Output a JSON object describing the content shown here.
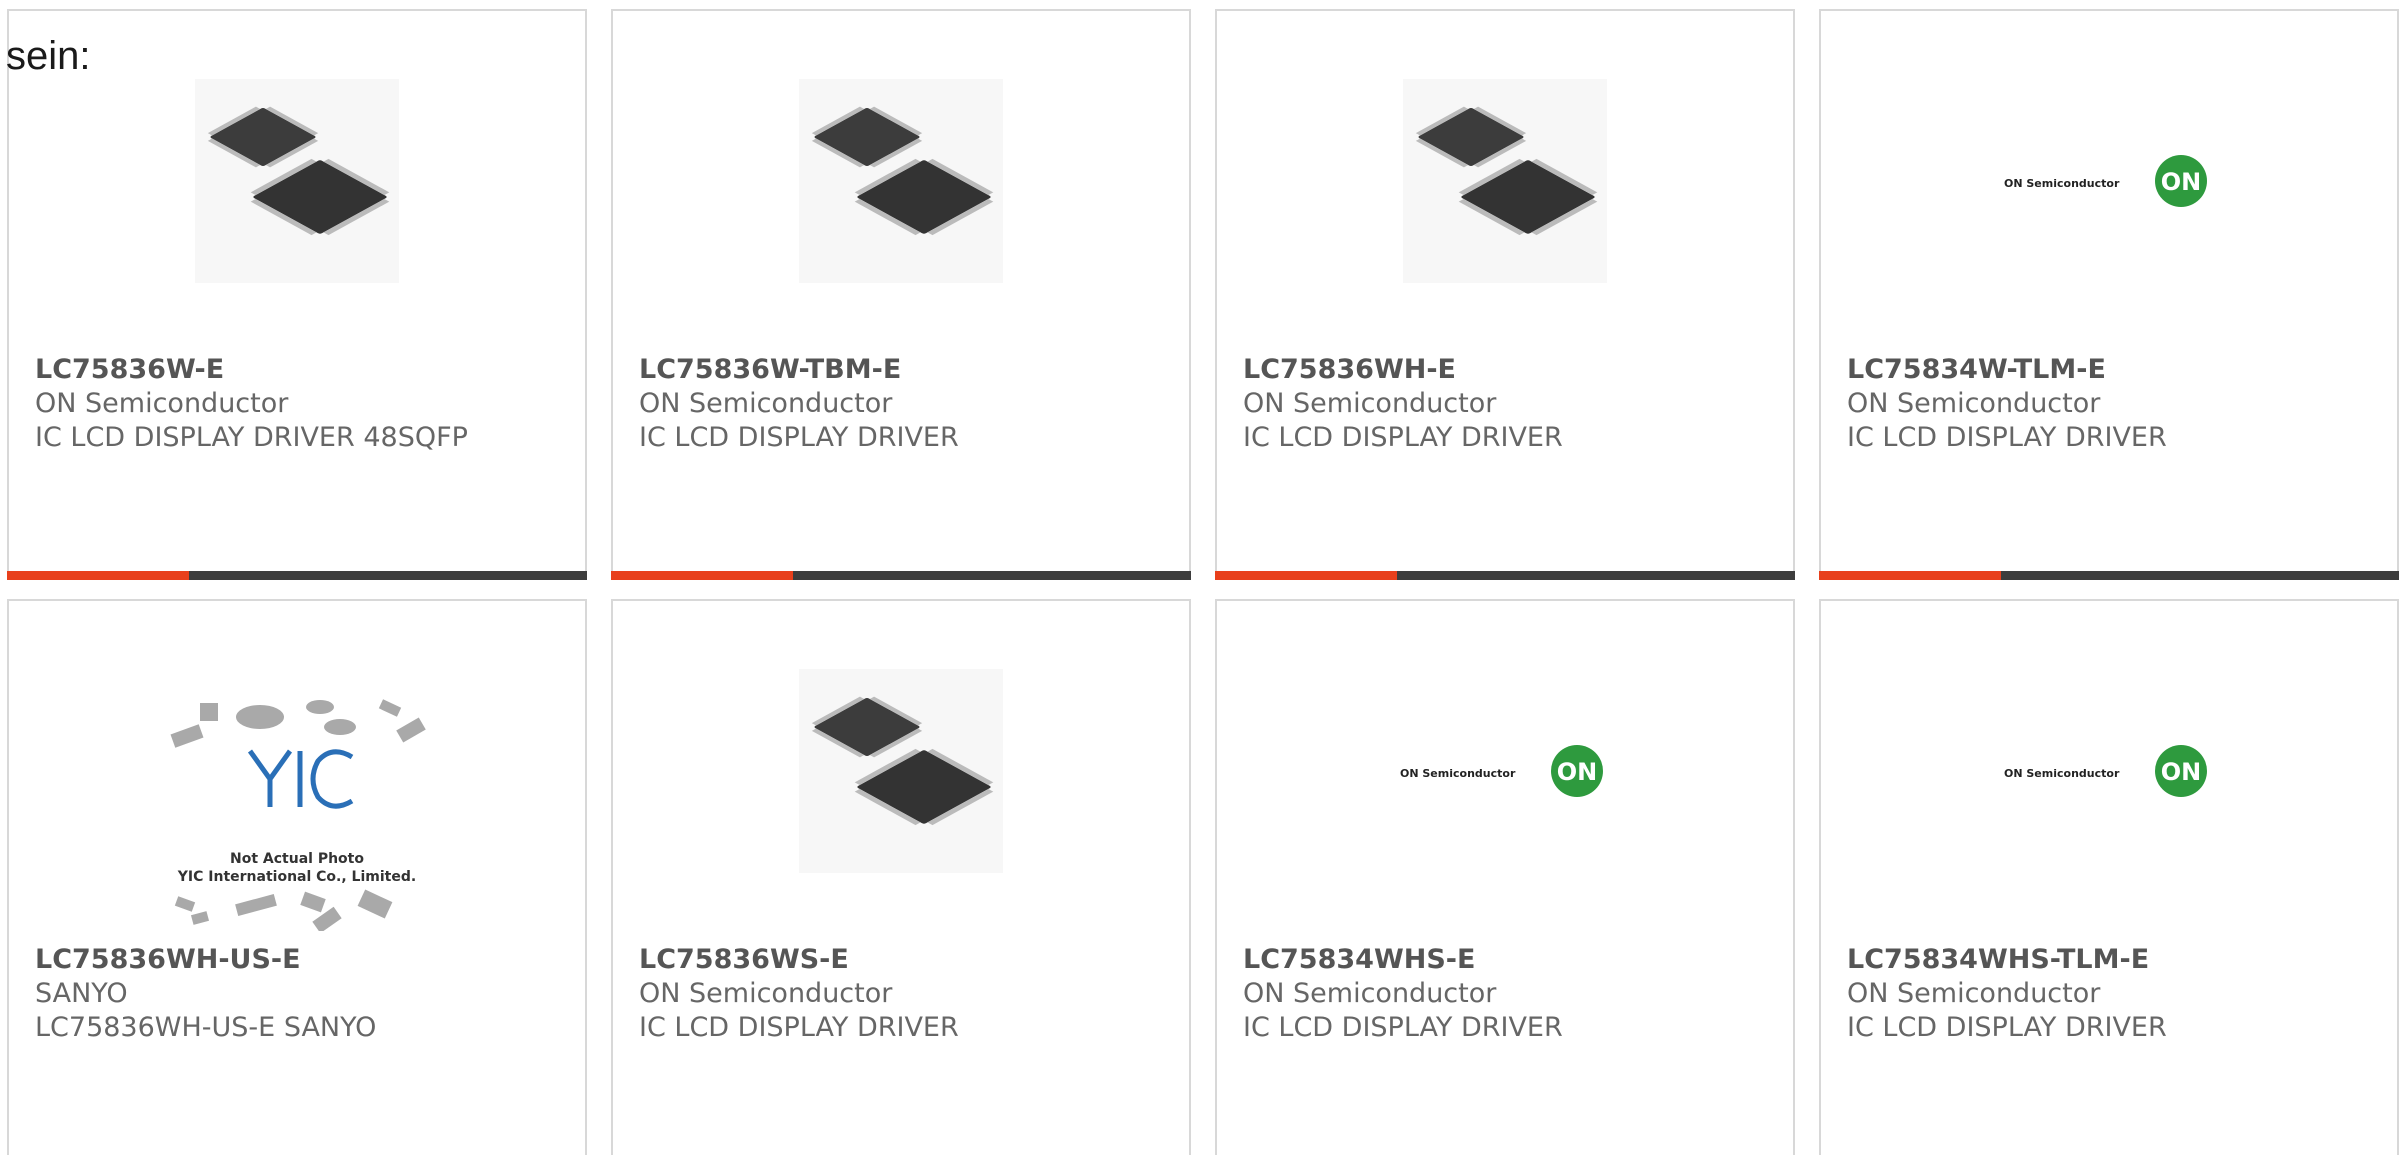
{
  "intro_text": "sein:",
  "products": [
    {
      "part_number": "LC75836W-E",
      "manufacturer": "ON Semiconductor",
      "description": "IC LCD DISPLAY DRIVER 48SQFP",
      "image": "chip-package-photo"
    },
    {
      "part_number": "LC75836W-TBM-E",
      "manufacturer": "ON Semiconductor",
      "description": "IC LCD DISPLAY DRIVER",
      "image": "chip-package-photo"
    },
    {
      "part_number": "LC75836WH-E",
      "manufacturer": "ON Semiconductor",
      "description": "IC LCD DISPLAY DRIVER",
      "image": "chip-package-photo"
    },
    {
      "part_number": "LC75834W-TLM-E",
      "manufacturer": "ON Semiconductor",
      "description": "IC LCD DISPLAY DRIVER",
      "image": "on-semiconductor-logo"
    },
    {
      "part_number": "LC75836WH-US-E",
      "manufacturer": "SANYO",
      "description": "LC75836WH-US-E SANYO",
      "image": "yic-not-actual-photo"
    },
    {
      "part_number": "LC75836WS-E",
      "manufacturer": "ON Semiconductor",
      "description": "IC LCD DISPLAY DRIVER",
      "image": "chip-package-photo"
    },
    {
      "part_number": "LC75834WHS-E",
      "manufacturer": "ON Semiconductor",
      "description": "IC LCD DISPLAY DRIVER",
      "image": "on-semiconductor-logo"
    },
    {
      "part_number": "LC75834WHS-TLM-E",
      "manufacturer": "ON Semiconductor",
      "description": "IC LCD DISPLAY DRIVER",
      "image": "on-semiconductor-logo"
    }
  ],
  "logo_text": {
    "on_semiconductor": "ON Semiconductor",
    "on_badge": "ON",
    "yic_mark": "YIC",
    "yic_note_1": "Not Actual Photo",
    "yic_note_2": "YIC International Co., Limited."
  },
  "colors": {
    "accent": "#e8401c",
    "bar": "#3d3d3d",
    "on_green": "#2e9a3e"
  }
}
